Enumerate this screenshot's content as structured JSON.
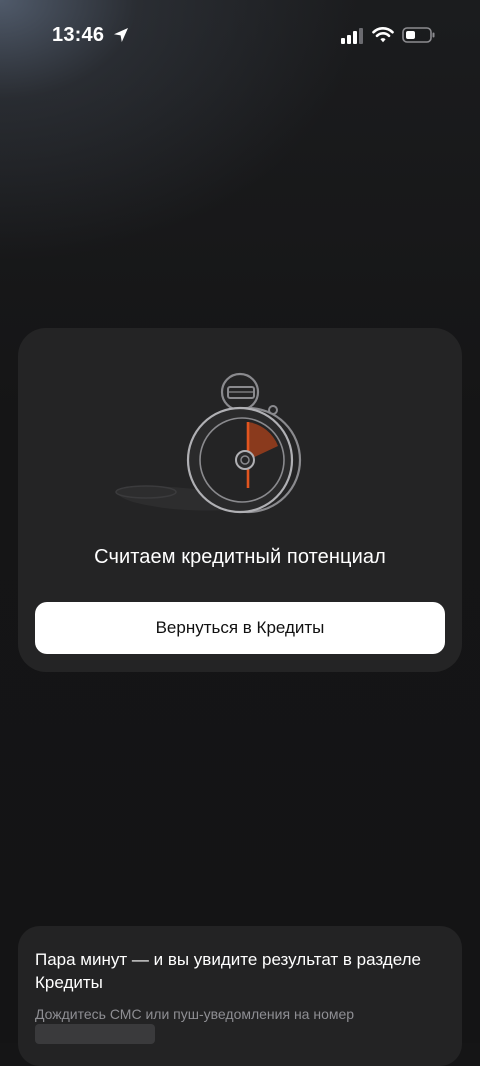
{
  "status_bar": {
    "time": "13:46",
    "icons": [
      "location-arrow-icon",
      "cellular-signal-icon",
      "wifi-icon",
      "battery-icon"
    ]
  },
  "main_card": {
    "illustration": "stopwatch-icon",
    "title": "Считаем кредитный потенциал",
    "button_label": "Вернуться в Кредиты"
  },
  "info_card": {
    "title": "Пара минут — и вы увидите результат в разделе Кредиты",
    "subtitle": "Дождитесь СМС или пуш-уведомления на номер"
  },
  "colors": {
    "background": "#151516",
    "card": "#242425",
    "button": "#ffffff",
    "accent_orange": "#e2551f",
    "muted_text": "#8e8e93"
  }
}
